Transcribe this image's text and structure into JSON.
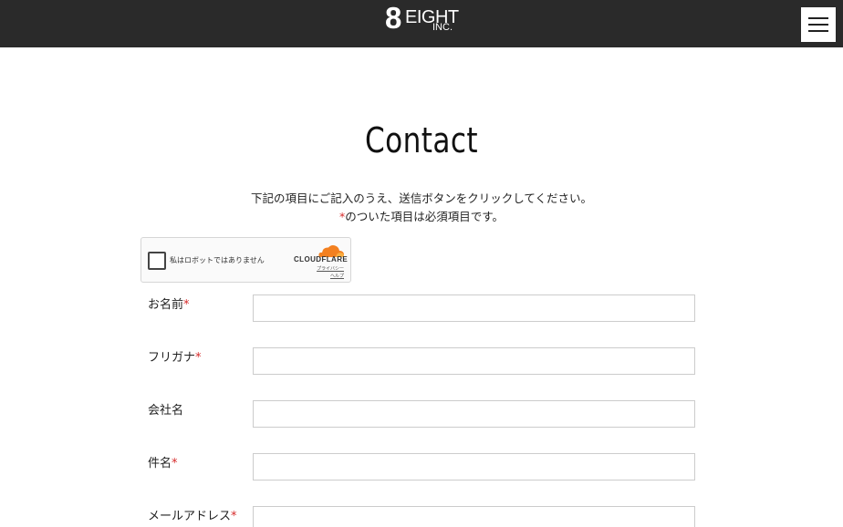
{
  "header": {
    "logo_numeral": "8",
    "logo_word": "EIGHT",
    "logo_suffix": "INC."
  },
  "page": {
    "title": "Contact",
    "intro_line1": "下記の項目にご記入のうえ、送信ボタンをクリックしてください。",
    "required_mark": "*",
    "intro_line2": "のついた項目は必須項目です。"
  },
  "captcha": {
    "label": "私はロボットではありません",
    "brand": "CLOUDFLARE",
    "privacy": "プライバシー",
    "help": "ヘルプ"
  },
  "form": {
    "fields": [
      {
        "label": "お名前",
        "required": "*",
        "value": ""
      },
      {
        "label": "フリガナ",
        "required": "*",
        "value": ""
      },
      {
        "label": "会社名",
        "required": "",
        "value": ""
      },
      {
        "label": "件名",
        "required": "*",
        "value": ""
      },
      {
        "label": "メールアドレス",
        "required": "*",
        "value": ""
      }
    ]
  },
  "colors": {
    "header_bg": "#2a2a2a",
    "required": "#d62a2a",
    "cloudflare_orange": "#f38020"
  }
}
